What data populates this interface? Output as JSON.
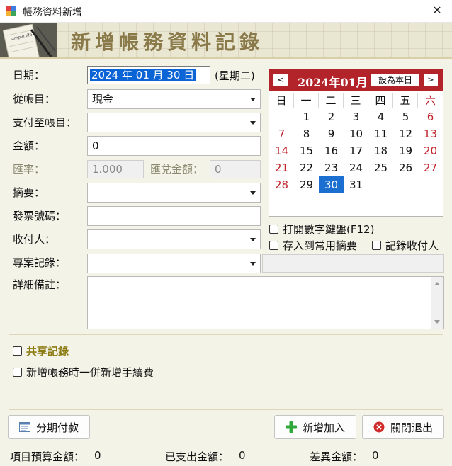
{
  "window": {
    "title": "帳務資料新增",
    "close_glyph": "✕"
  },
  "banner": {
    "title": "新增帳務資料記錄",
    "notebook_text": "simple life"
  },
  "form": {
    "date_label": "日期：",
    "date_value": "2024 年 01 月 30 日",
    "weekday": "(星期二)",
    "from_account_label": "從帳目：",
    "from_account_value": "現金",
    "pay_to_label": "支付至帳目：",
    "pay_to_value": "",
    "amount_label": "金額：",
    "amount_value": "0",
    "rate_label": "匯率：",
    "rate_value": "1.000",
    "exchange_amount_label": "匯兌金額：",
    "exchange_amount_value": "0",
    "summary_label": "摘要：",
    "summary_value": "",
    "invoice_label": "發票號碼：",
    "invoice_value": "",
    "payee_label": "收付人：",
    "payee_value": "",
    "project_label": "專案記錄：",
    "project_value": "",
    "notes_label": "詳細備註：",
    "notes_value": ""
  },
  "calendar": {
    "prev": "<",
    "next": ">",
    "month_title": "2024年01月",
    "today_button": "設為本日",
    "weekdays": [
      "日",
      "一",
      "二",
      "三",
      "四",
      "五",
      "六"
    ],
    "weeks": [
      [
        "",
        "1",
        "2",
        "3",
        "4",
        "5",
        "6"
      ],
      [
        "7",
        "8",
        "9",
        "10",
        "11",
        "12",
        "13"
      ],
      [
        "14",
        "15",
        "16",
        "17",
        "18",
        "19",
        "20"
      ],
      [
        "21",
        "22",
        "23",
        "24",
        "25",
        "26",
        "27"
      ],
      [
        "28",
        "29",
        "30",
        "31",
        "",
        "",
        ""
      ]
    ],
    "selected_day": "30",
    "accent_color": "#b3232a",
    "selected_color": "#1a6fd0"
  },
  "options": {
    "numpad": "打開數字鍵盤(F12)",
    "save_common_summary": "存入到常用摘要",
    "record_payee": "記錄收付人",
    "shared_record": "共享記錄",
    "add_fee": "新增帳務時一併新增手續費"
  },
  "buttons": {
    "installment": "分期付款",
    "add": "新增加入",
    "close": "關閉退出"
  },
  "status": {
    "budget_label": "項目預算金額：",
    "budget_value": "0",
    "spent_label": "已支出金額：",
    "spent_value": "0",
    "diff_label": "差異金額：",
    "diff_value": "0"
  }
}
